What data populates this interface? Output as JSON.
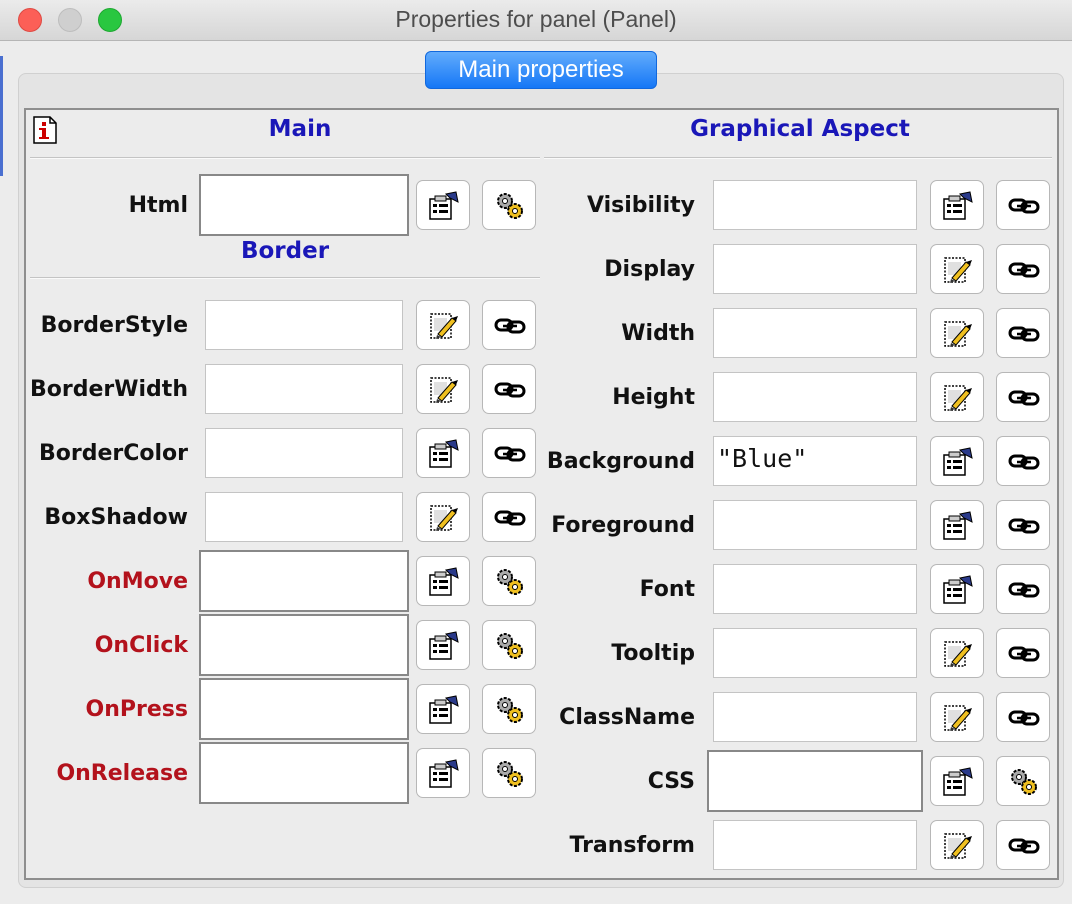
{
  "window": {
    "title": "Properties for panel (Panel)"
  },
  "tab": {
    "label": "Main properties"
  },
  "left": {
    "main_header": "Main",
    "border_header": "Border",
    "rows": [
      {
        "label": "Html",
        "value": "",
        "kind": "event",
        "action": "gears"
      },
      {
        "label": "BorderStyle",
        "value": "",
        "kind": "prop",
        "action": "link"
      },
      {
        "label": "BorderWidth",
        "value": "",
        "kind": "prop",
        "action": "link"
      },
      {
        "label": "BorderColor",
        "value": "",
        "kind": "prop",
        "action": "link"
      },
      {
        "label": "BoxShadow",
        "value": "",
        "kind": "prop",
        "action": "link"
      },
      {
        "label": "OnMove",
        "value": "",
        "kind": "event",
        "action": "gears"
      },
      {
        "label": "OnClick",
        "value": "",
        "kind": "event",
        "action": "gears"
      },
      {
        "label": "OnPress",
        "value": "",
        "kind": "event",
        "action": "gears"
      },
      {
        "label": "OnRelease",
        "value": "",
        "kind": "event",
        "action": "gears"
      }
    ]
  },
  "right": {
    "header": "Graphical Aspect",
    "rows": [
      {
        "label": "Visibility",
        "value": "",
        "kind": "prop",
        "action": "link"
      },
      {
        "label": "Display",
        "value": "",
        "kind": "prop",
        "action": "link"
      },
      {
        "label": "Width",
        "value": "",
        "kind": "prop",
        "action": "link"
      },
      {
        "label": "Height",
        "value": "",
        "kind": "prop",
        "action": "link"
      },
      {
        "label": "Background",
        "value": "\"Blue\"",
        "kind": "prop",
        "action": "link"
      },
      {
        "label": "Foreground",
        "value": "",
        "kind": "prop",
        "action": "link"
      },
      {
        "label": "Font",
        "value": "",
        "kind": "prop",
        "action": "link"
      },
      {
        "label": "Tooltip",
        "value": "",
        "kind": "prop",
        "action": "link"
      },
      {
        "label": "ClassName",
        "value": "",
        "kind": "prop",
        "action": "link"
      },
      {
        "label": "CSS",
        "value": "",
        "kind": "event",
        "action": "gears"
      },
      {
        "label": "Transform",
        "value": "",
        "kind": "prop",
        "action": "link"
      }
    ]
  },
  "colors": {
    "section_header": "#1a17b8",
    "event_label": "#b3121c",
    "tab_accent": "#1577f6"
  }
}
